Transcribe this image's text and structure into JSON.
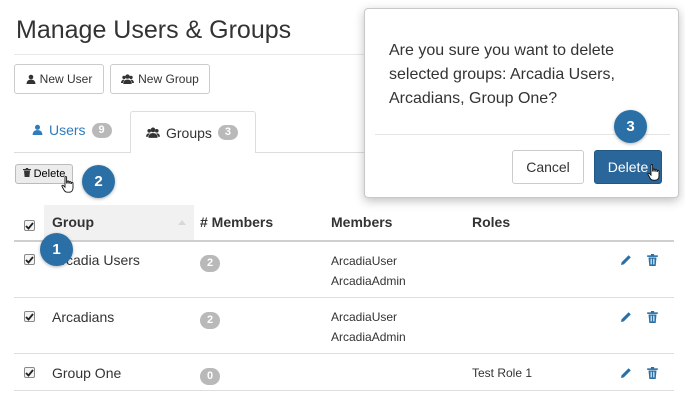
{
  "page": {
    "title": "Manage Users & Groups"
  },
  "toolbar": {
    "new_user_label": "New User",
    "new_group_label": "New Group"
  },
  "tabs": [
    {
      "label": "Users",
      "count": "9",
      "active": false
    },
    {
      "label": "Groups",
      "count": "3",
      "active": true
    }
  ],
  "actions": {
    "delete_label": "Delete"
  },
  "table": {
    "columns": [
      "Group",
      "# Members",
      "Members",
      "Roles"
    ],
    "rows": [
      {
        "checked": true,
        "group": "Arcadia Users",
        "member_count": "2",
        "members": [
          "ArcadiaUser",
          "ArcadiaAdmin"
        ],
        "roles": ""
      },
      {
        "checked": true,
        "group": "Arcadians",
        "member_count": "2",
        "members": [
          "ArcadiaUser",
          "ArcadiaAdmin"
        ],
        "roles": ""
      },
      {
        "checked": true,
        "group": "Group One",
        "member_count": "0",
        "members": [],
        "roles": "Test Role 1"
      }
    ]
  },
  "modal": {
    "message": "Are you sure you want to delete selected groups: Arcadia Users, Arcadians, Group One?",
    "cancel_label": "Cancel",
    "confirm_label": "Delete"
  },
  "callouts": [
    "1",
    "2",
    "3"
  ],
  "icons": {
    "new_user": "user-icon",
    "new_group": "users-icon",
    "delete": "trash-icon",
    "edit": "pencil-icon",
    "cursor": "hand-pointer-icon"
  },
  "colors": {
    "accent": "#2a70a6",
    "link": "#2e7bbd",
    "primary_button": "#2a6699",
    "badge": "#b9b9b9"
  }
}
